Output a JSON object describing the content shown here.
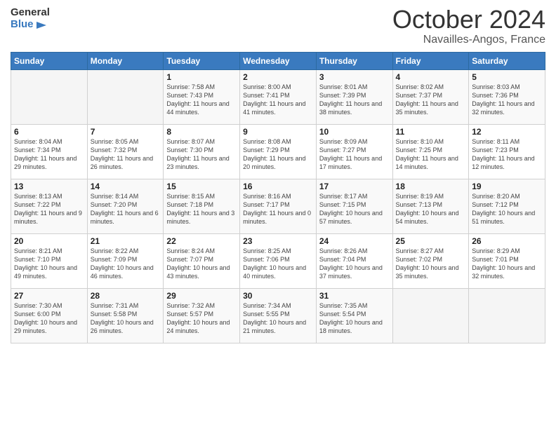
{
  "logo": {
    "line1": "General",
    "line2": "Blue"
  },
  "header": {
    "month": "October 2024",
    "location": "Navailles-Angos, France"
  },
  "days_of_week": [
    "Sunday",
    "Monday",
    "Tuesday",
    "Wednesday",
    "Thursday",
    "Friday",
    "Saturday"
  ],
  "weeks": [
    [
      {
        "day": "",
        "info": ""
      },
      {
        "day": "",
        "info": ""
      },
      {
        "day": "1",
        "info": "Sunrise: 7:58 AM\nSunset: 7:43 PM\nDaylight: 11 hours and 44 minutes."
      },
      {
        "day": "2",
        "info": "Sunrise: 8:00 AM\nSunset: 7:41 PM\nDaylight: 11 hours and 41 minutes."
      },
      {
        "day": "3",
        "info": "Sunrise: 8:01 AM\nSunset: 7:39 PM\nDaylight: 11 hours and 38 minutes."
      },
      {
        "day": "4",
        "info": "Sunrise: 8:02 AM\nSunset: 7:37 PM\nDaylight: 11 hours and 35 minutes."
      },
      {
        "day": "5",
        "info": "Sunrise: 8:03 AM\nSunset: 7:36 PM\nDaylight: 11 hours and 32 minutes."
      }
    ],
    [
      {
        "day": "6",
        "info": "Sunrise: 8:04 AM\nSunset: 7:34 PM\nDaylight: 11 hours and 29 minutes."
      },
      {
        "day": "7",
        "info": "Sunrise: 8:05 AM\nSunset: 7:32 PM\nDaylight: 11 hours and 26 minutes."
      },
      {
        "day": "8",
        "info": "Sunrise: 8:07 AM\nSunset: 7:30 PM\nDaylight: 11 hours and 23 minutes."
      },
      {
        "day": "9",
        "info": "Sunrise: 8:08 AM\nSunset: 7:29 PM\nDaylight: 11 hours and 20 minutes."
      },
      {
        "day": "10",
        "info": "Sunrise: 8:09 AM\nSunset: 7:27 PM\nDaylight: 11 hours and 17 minutes."
      },
      {
        "day": "11",
        "info": "Sunrise: 8:10 AM\nSunset: 7:25 PM\nDaylight: 11 hours and 14 minutes."
      },
      {
        "day": "12",
        "info": "Sunrise: 8:11 AM\nSunset: 7:23 PM\nDaylight: 11 hours and 12 minutes."
      }
    ],
    [
      {
        "day": "13",
        "info": "Sunrise: 8:13 AM\nSunset: 7:22 PM\nDaylight: 11 hours and 9 minutes."
      },
      {
        "day": "14",
        "info": "Sunrise: 8:14 AM\nSunset: 7:20 PM\nDaylight: 11 hours and 6 minutes."
      },
      {
        "day": "15",
        "info": "Sunrise: 8:15 AM\nSunset: 7:18 PM\nDaylight: 11 hours and 3 minutes."
      },
      {
        "day": "16",
        "info": "Sunrise: 8:16 AM\nSunset: 7:17 PM\nDaylight: 11 hours and 0 minutes."
      },
      {
        "day": "17",
        "info": "Sunrise: 8:17 AM\nSunset: 7:15 PM\nDaylight: 10 hours and 57 minutes."
      },
      {
        "day": "18",
        "info": "Sunrise: 8:19 AM\nSunset: 7:13 PM\nDaylight: 10 hours and 54 minutes."
      },
      {
        "day": "19",
        "info": "Sunrise: 8:20 AM\nSunset: 7:12 PM\nDaylight: 10 hours and 51 minutes."
      }
    ],
    [
      {
        "day": "20",
        "info": "Sunrise: 8:21 AM\nSunset: 7:10 PM\nDaylight: 10 hours and 49 minutes."
      },
      {
        "day": "21",
        "info": "Sunrise: 8:22 AM\nSunset: 7:09 PM\nDaylight: 10 hours and 46 minutes."
      },
      {
        "day": "22",
        "info": "Sunrise: 8:24 AM\nSunset: 7:07 PM\nDaylight: 10 hours and 43 minutes."
      },
      {
        "day": "23",
        "info": "Sunrise: 8:25 AM\nSunset: 7:06 PM\nDaylight: 10 hours and 40 minutes."
      },
      {
        "day": "24",
        "info": "Sunrise: 8:26 AM\nSunset: 7:04 PM\nDaylight: 10 hours and 37 minutes."
      },
      {
        "day": "25",
        "info": "Sunrise: 8:27 AM\nSunset: 7:02 PM\nDaylight: 10 hours and 35 minutes."
      },
      {
        "day": "26",
        "info": "Sunrise: 8:29 AM\nSunset: 7:01 PM\nDaylight: 10 hours and 32 minutes."
      }
    ],
    [
      {
        "day": "27",
        "info": "Sunrise: 7:30 AM\nSunset: 6:00 PM\nDaylight: 10 hours and 29 minutes."
      },
      {
        "day": "28",
        "info": "Sunrise: 7:31 AM\nSunset: 5:58 PM\nDaylight: 10 hours and 26 minutes."
      },
      {
        "day": "29",
        "info": "Sunrise: 7:32 AM\nSunset: 5:57 PM\nDaylight: 10 hours and 24 minutes."
      },
      {
        "day": "30",
        "info": "Sunrise: 7:34 AM\nSunset: 5:55 PM\nDaylight: 10 hours and 21 minutes."
      },
      {
        "day": "31",
        "info": "Sunrise: 7:35 AM\nSunset: 5:54 PM\nDaylight: 10 hours and 18 minutes."
      },
      {
        "day": "",
        "info": ""
      },
      {
        "day": "",
        "info": ""
      }
    ]
  ]
}
